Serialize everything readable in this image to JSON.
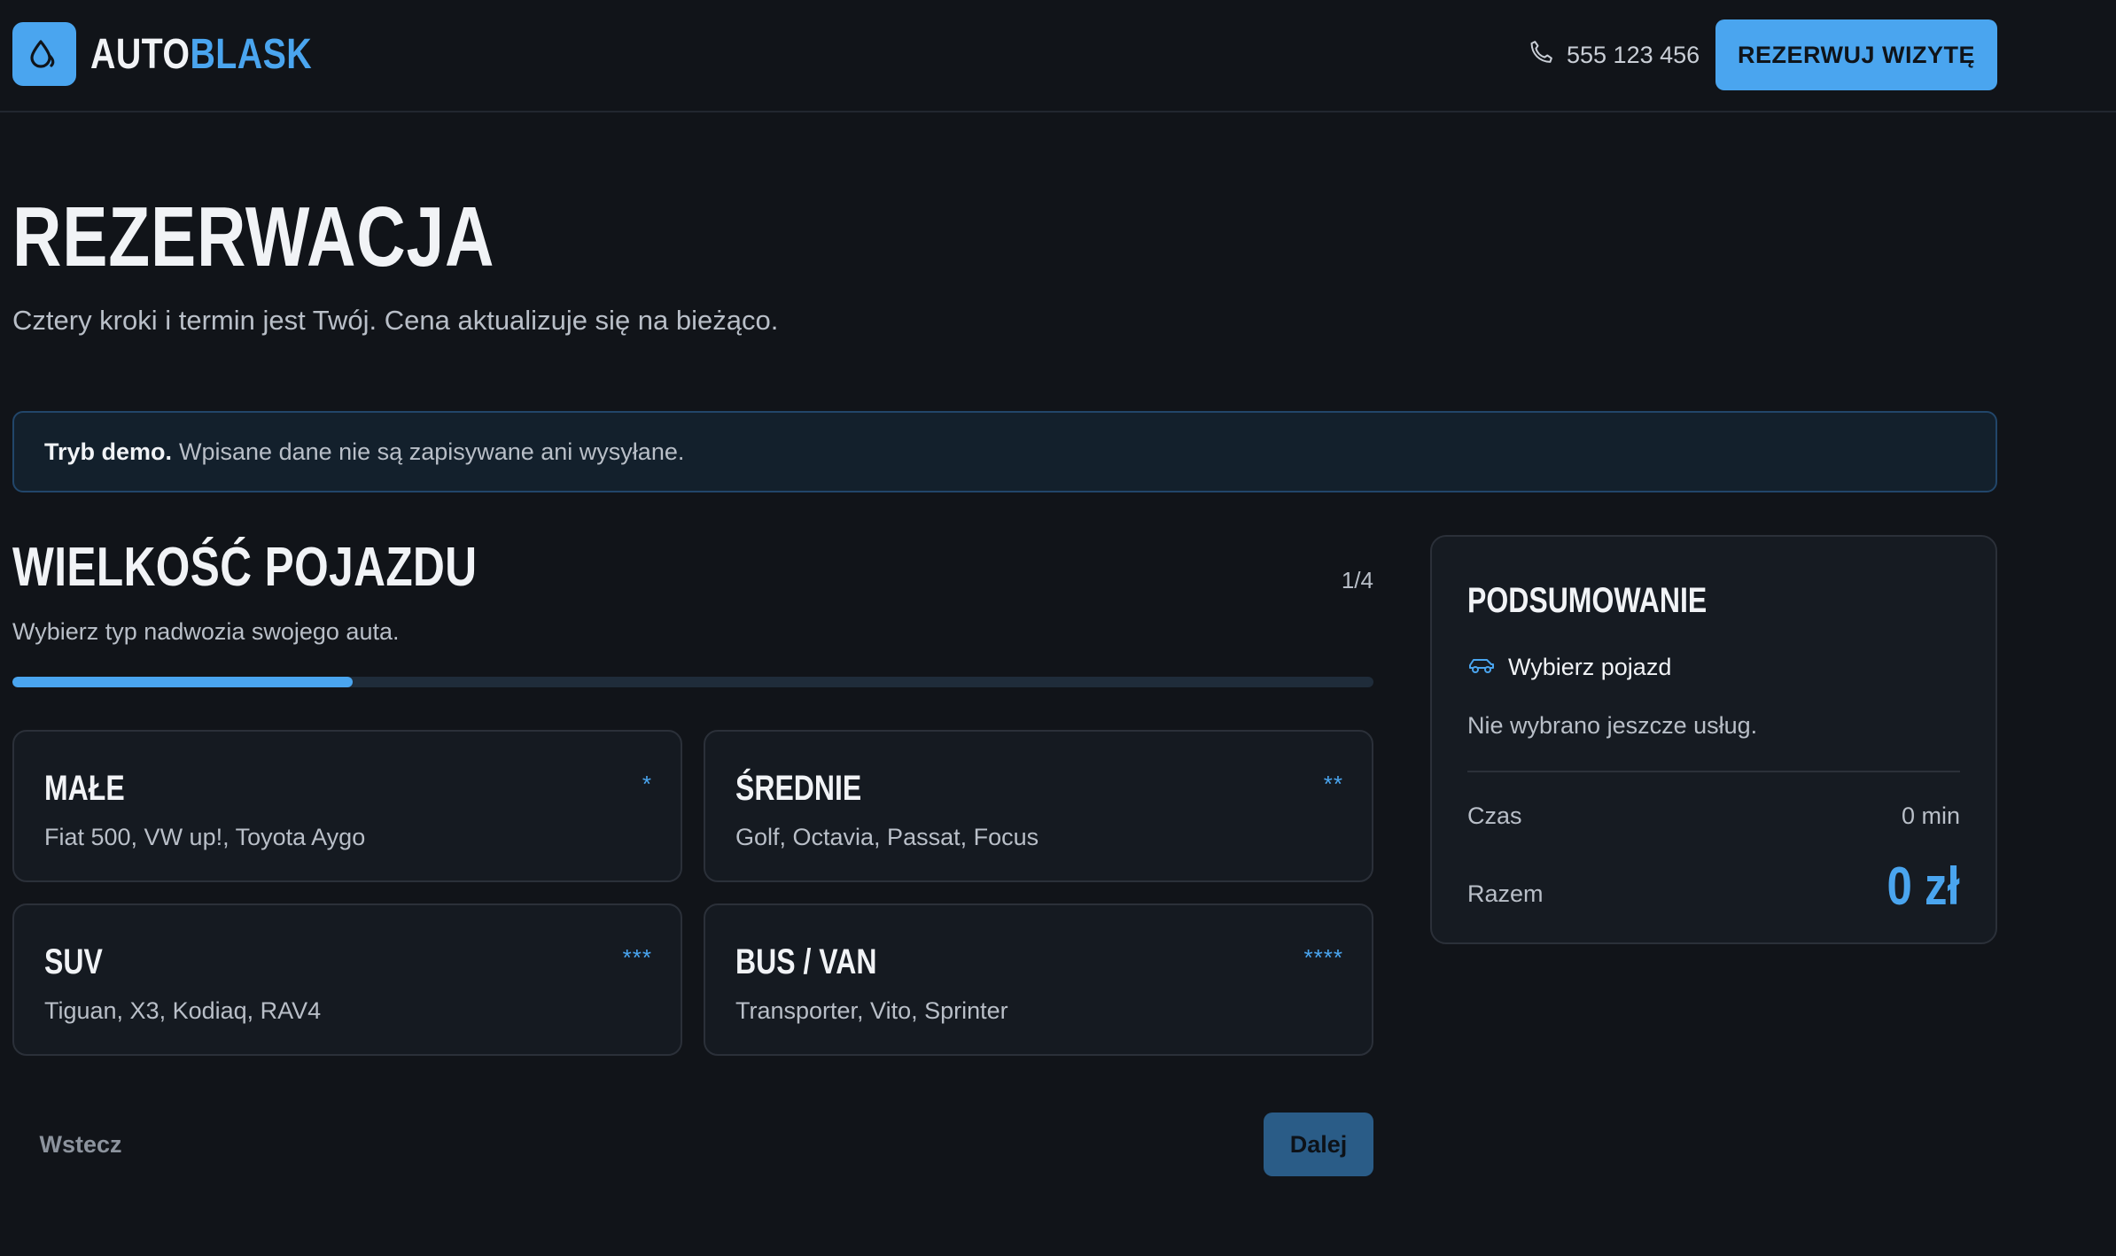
{
  "header": {
    "brand_part1": "AUTO",
    "brand_part2": "BLASK",
    "phone": "555 123 456",
    "cta_label": "REZERWUJ WIZYTĘ"
  },
  "page": {
    "title": "REZERWACJA",
    "subtitle": "Cztery kroki i termin jest Twój. Cena aktualizuje się na bieżąco."
  },
  "demo_notice": {
    "bold": "Tryb demo.",
    "text": "Wpisane dane nie są zapisywane ani wysyłane."
  },
  "step": {
    "title": "WIELKOŚĆ POJAZDU",
    "counter": "1/4",
    "description": "Wybierz typ nadwozia swojego auta.",
    "progress_fraction": 0.25
  },
  "vehicle_options": [
    {
      "name": "MAŁE",
      "models": "Fiat 500, VW up!, Toyota Aygo",
      "stars": "*"
    },
    {
      "name": "ŚREDNIE",
      "models": "Golf, Octavia, Passat, Focus",
      "stars": "**"
    },
    {
      "name": "SUV",
      "models": "Tiguan, X3, Kodiaq, RAV4",
      "stars": "***"
    },
    {
      "name": "BUS / VAN",
      "models": "Transporter, Vito, Sprinter",
      "stars": "****"
    }
  ],
  "nav": {
    "back_label": "Wstecz",
    "next_label": "Dalej"
  },
  "summary": {
    "title": "PODSUMOWANIE",
    "vehicle_placeholder": "Wybierz pojazd",
    "empty_services": "Nie wybrano jeszcze usług.",
    "time_label": "Czas",
    "time_value": "0 min",
    "total_label": "Razem",
    "total_value": "0 zł"
  },
  "colors": {
    "background": "#111419",
    "accent": "#4aa5ef",
    "card": "#151a21",
    "border": "#2b3039"
  }
}
